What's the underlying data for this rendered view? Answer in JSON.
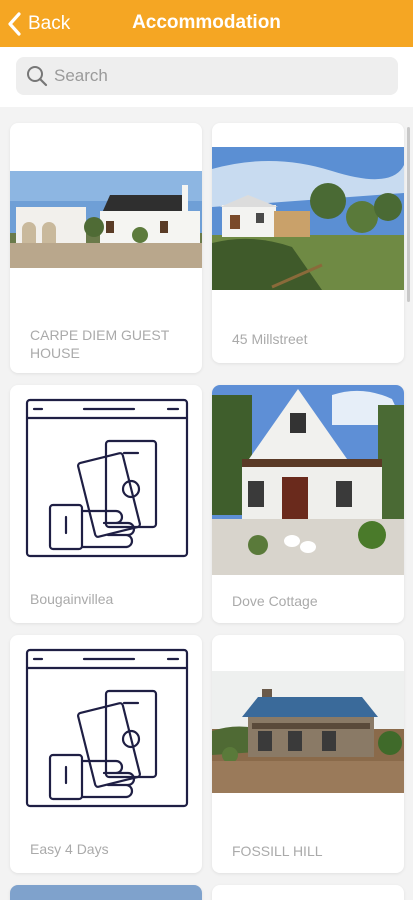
{
  "header": {
    "back_label": "Back",
    "title": "Accommodation",
    "bar_color": "#f5a623"
  },
  "search": {
    "placeholder": "Search",
    "value": ""
  },
  "listings": [
    {
      "label": "CARPE DIEM GUEST HOUSE",
      "image": "farmhouse-photo"
    },
    {
      "label": "45 Millstreet",
      "image": "millstreet-house-photo"
    },
    {
      "label": "Bougainvillea",
      "image": "payment-hand-icon"
    },
    {
      "label": "Dove Cottage",
      "image": "cottage-with-geese-photo"
    },
    {
      "label": "Easy 4 Days",
      "image": "payment-hand-icon"
    },
    {
      "label": "FOSSILL HILL",
      "image": "stone-house-photo"
    }
  ]
}
